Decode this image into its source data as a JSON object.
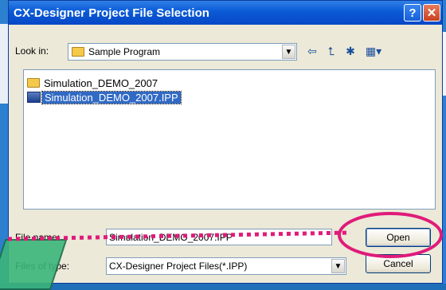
{
  "dialog": {
    "title": "CX-Designer Project File Selection",
    "help_label": "?",
    "close_label": "✕"
  },
  "lookin": {
    "label": "Look in:",
    "value": "Sample Program"
  },
  "toolbar": {
    "back_icon": "back-arrow-icon",
    "up_icon": "up-folder-icon",
    "new_folder_icon": "new-folder-icon",
    "view_icon": "view-menu-icon"
  },
  "files": [
    {
      "name": "Simulation_DEMO_2007",
      "type": "folder"
    },
    {
      "name": "Simulation_DEMO_2007.IPP",
      "type": "ipp",
      "selected": true
    }
  ],
  "filename": {
    "label": "File name:",
    "value": "Simulation_DEMO_2007.IPP"
  },
  "filetype": {
    "label": "Files of type:",
    "value": "CX-Designer Project Files(*.IPP)"
  },
  "buttons": {
    "open": "Open",
    "cancel": "Cancel"
  },
  "colors": {
    "accent": "#e01b7a",
    "title_blue": "#0a5ad6",
    "selection": "#316ac5"
  }
}
